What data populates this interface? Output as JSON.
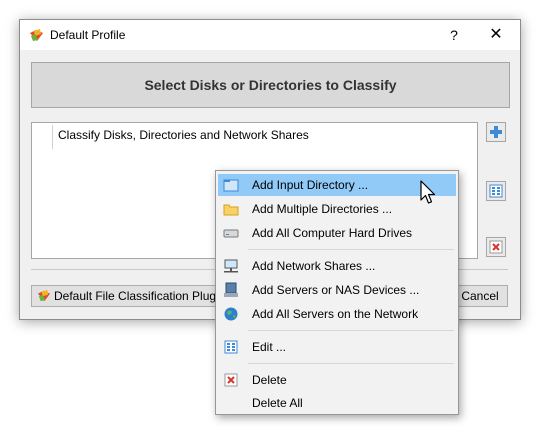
{
  "window": {
    "title": "Default Profile",
    "help_label": "?",
    "close_label": "✕"
  },
  "banner": {
    "heading": "Select Disks or Directories to Classify"
  },
  "list": {
    "items": [
      {
        "label": "Classify Disks, Directories and Network Shares"
      }
    ]
  },
  "footer": {
    "plugin_label": "Default File Classification Plugin",
    "cancel_label": "Cancel"
  },
  "context_menu": {
    "items": [
      {
        "label": "Add Input Directory ...",
        "icon": "folder-blue-icon",
        "highlighted": true
      },
      {
        "label": "Add Multiple Directories ...",
        "icon": "folder-yellow-icon"
      },
      {
        "label": "Add All Computer Hard Drives",
        "icon": "hard-drive-icon"
      },
      {
        "label": "Add Network Shares ...",
        "icon": "network-share-icon"
      },
      {
        "label": "Add Servers or NAS Devices ...",
        "icon": "server-icon"
      },
      {
        "label": "Add All Servers on the Network",
        "icon": "globe-icon"
      },
      {
        "label": "Edit ...",
        "icon": "edit-icon"
      },
      {
        "label": "Delete",
        "icon": "delete-icon"
      },
      {
        "label": "Delete All",
        "icon": ""
      }
    ]
  },
  "colors": {
    "highlight": "#91c9f7",
    "accent_blue": "#3c8ad8"
  }
}
